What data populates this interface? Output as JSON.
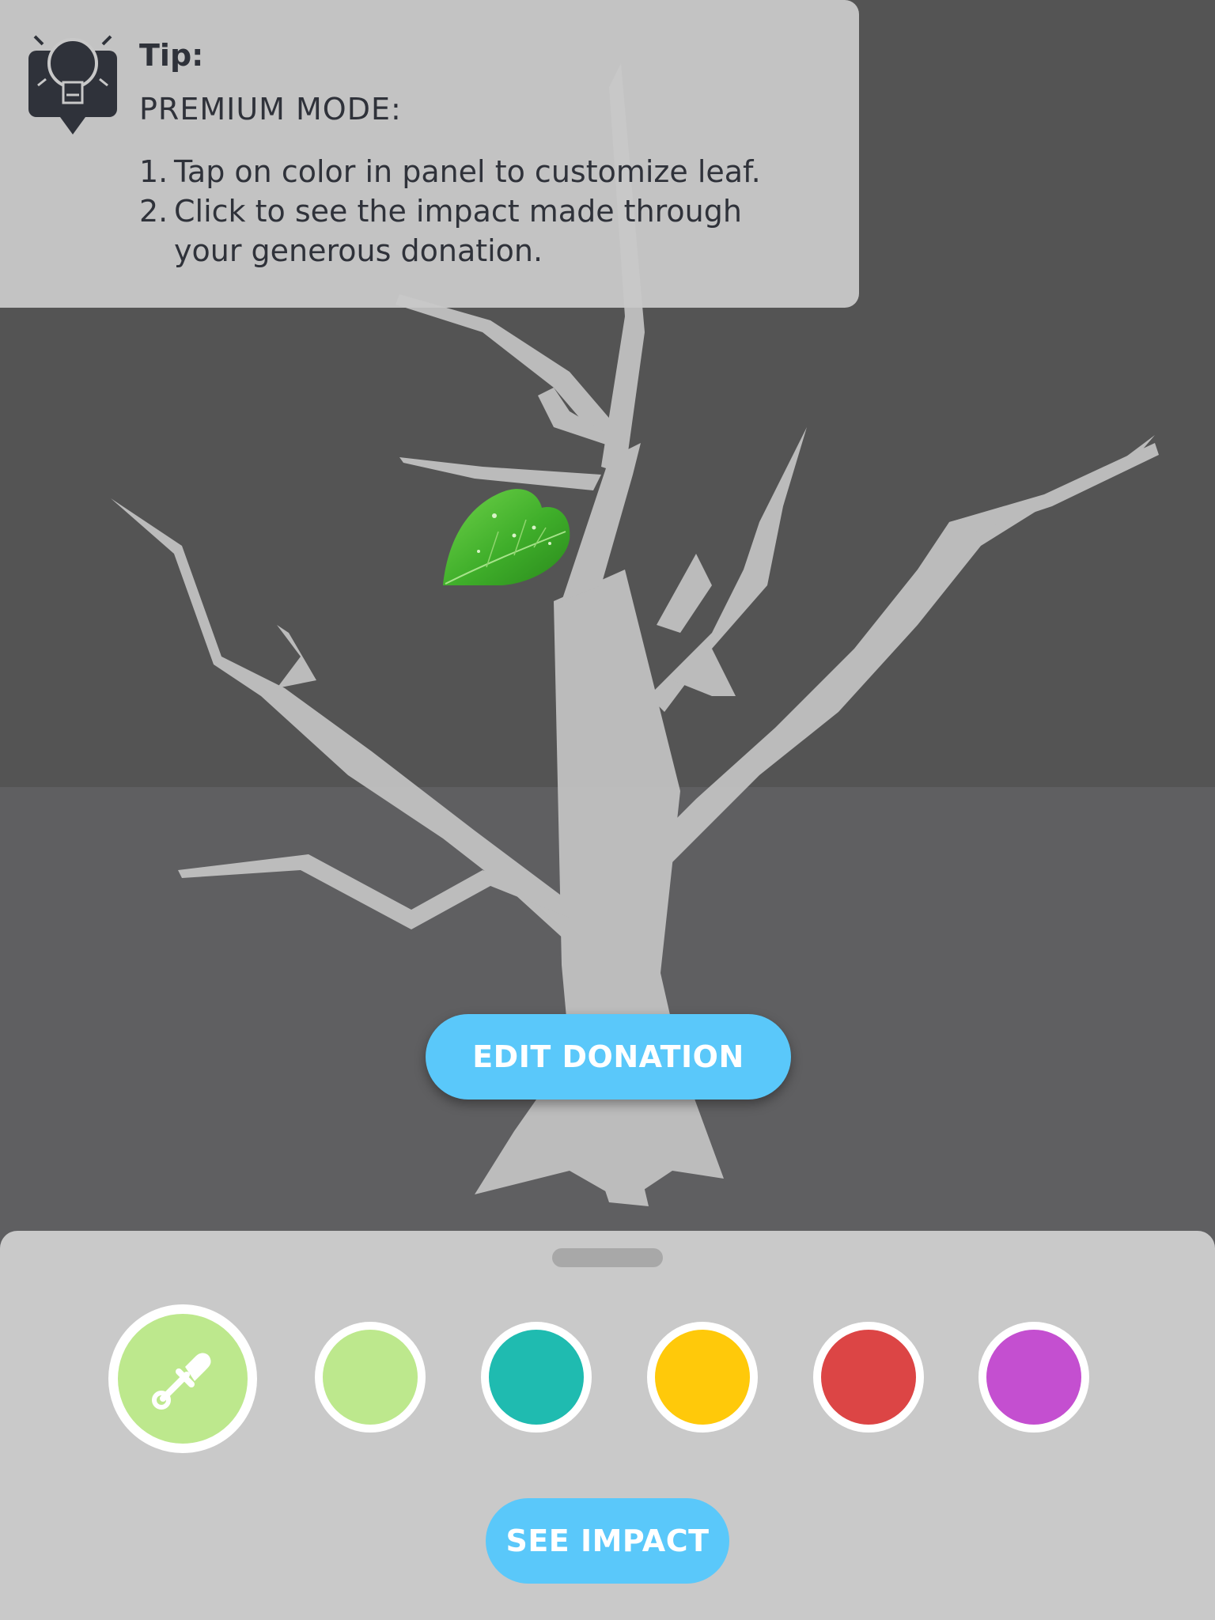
{
  "tip": {
    "title": "Tip:",
    "heading": "PREMIUM MODE:",
    "step1_num": "1.",
    "step1_text": "Tap on color in panel to customize leaf.",
    "step2_num": "2.",
    "step2_line1": "Click to see the impact made through",
    "step2_line2": "your generous donation.",
    "icon": "lightbulb-icon"
  },
  "scene": {
    "tree": "bare-tree-illustration",
    "leaf_color": "#3fae2a"
  },
  "actions": {
    "edit_donation_label": "EDIT DONATION",
    "see_impact_label": "SEE IMPACT",
    "button_color": "#5ac8fa"
  },
  "palette": {
    "picker_icon": "eyedropper-icon",
    "picker_color": "#bde88d",
    "swatches": [
      {
        "name": "light-green",
        "color": "#bde88d"
      },
      {
        "name": "teal",
        "color": "#1fbbb0"
      },
      {
        "name": "yellow",
        "color": "#ffc90a"
      },
      {
        "name": "red",
        "color": "#dc4545"
      },
      {
        "name": "purple",
        "color": "#c44fd0"
      }
    ]
  }
}
